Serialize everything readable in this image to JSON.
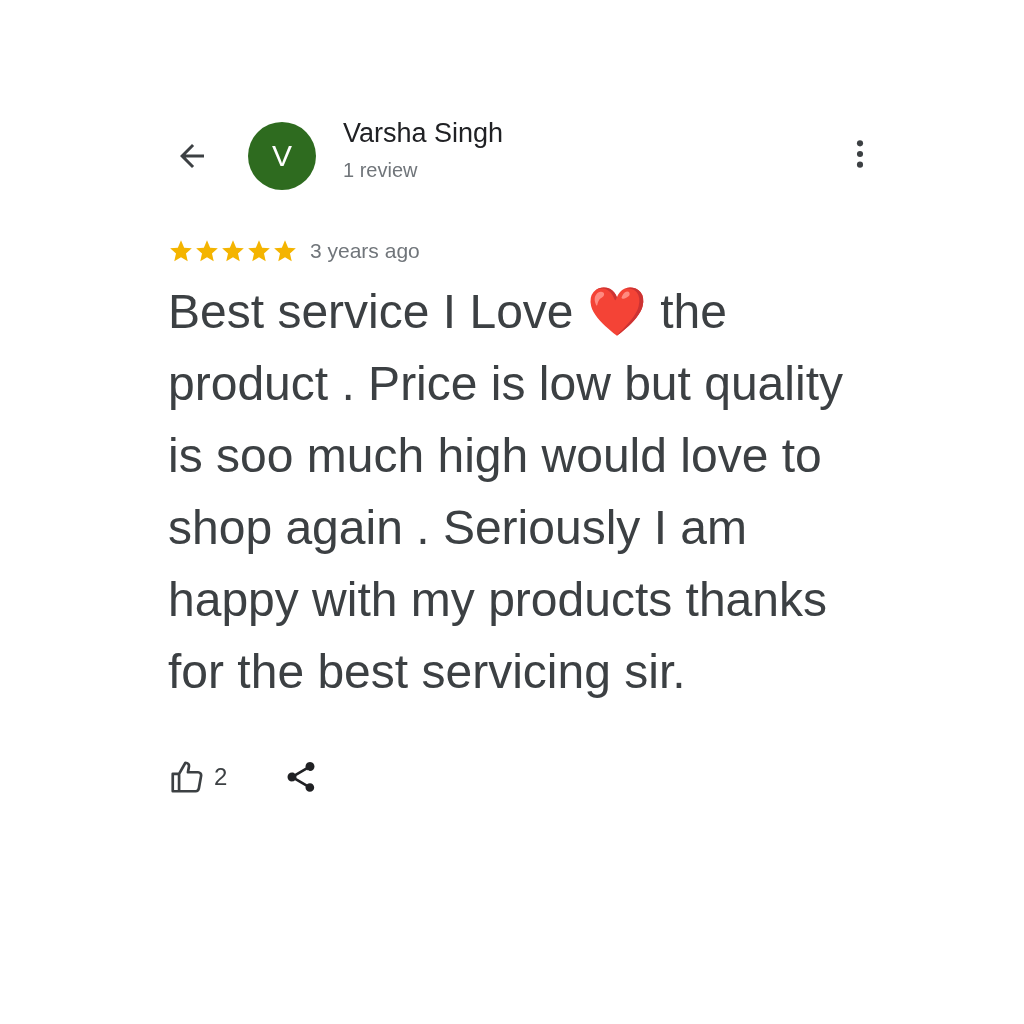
{
  "reviewer": {
    "initial": "V",
    "name": "Varsha Singh",
    "reviews": "1 review"
  },
  "rating": {
    "stars": 5,
    "time": "3 years ago"
  },
  "review_text": "Best service I Love ❤️ the product . Price is low but quality is soo much high would love to shop again . Seriously I am happy with my products thanks for the best servicing sir.",
  "likes": "2"
}
